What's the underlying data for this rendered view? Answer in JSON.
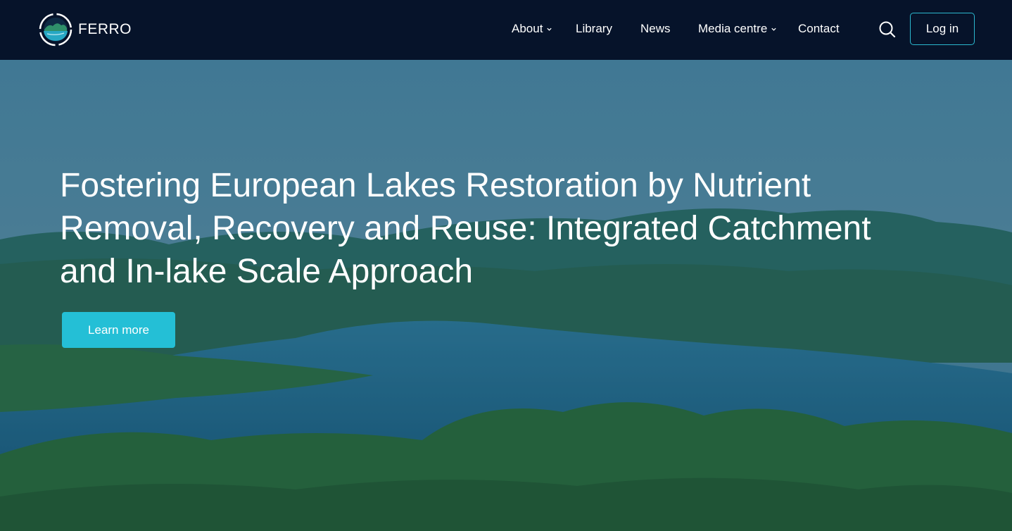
{
  "brand": {
    "name": "FERRO",
    "logo_icon": "ferro-lake-logo"
  },
  "nav": {
    "items": [
      {
        "label": "About",
        "has_dropdown": true
      },
      {
        "label": "Library",
        "has_dropdown": false
      },
      {
        "label": "News",
        "has_dropdown": false
      },
      {
        "label": "Media centre",
        "has_dropdown": true
      },
      {
        "label": "Contact",
        "has_dropdown": false
      }
    ],
    "search_icon": "search-icon",
    "login_label": "Log in"
  },
  "hero": {
    "title": "Fostering European Lakes Restoration by Nutrient Removal, Recovery and Reuse: Integrated Catchment and In-lake Scale Approach",
    "cta_label": "Learn more"
  },
  "colors": {
    "header_bg": "#06132a",
    "accent": "#24bfd6",
    "login_border": "#2bb8cf"
  }
}
